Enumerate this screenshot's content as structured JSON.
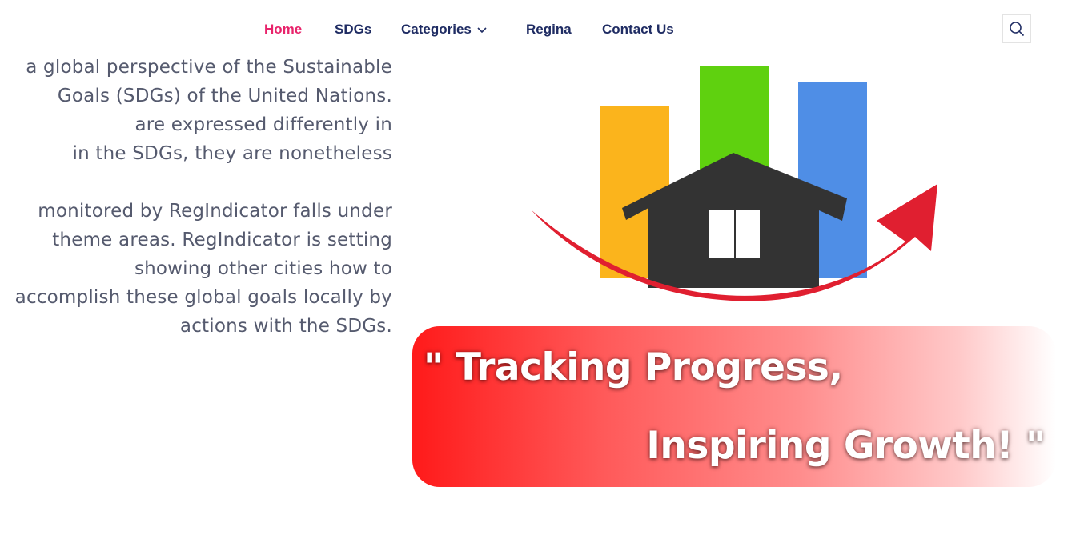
{
  "nav": {
    "items": [
      {
        "label": "Home",
        "active": true
      },
      {
        "label": "SDGs"
      },
      {
        "label": "Categories",
        "has_dropdown": true
      },
      {
        "label": "Regina"
      },
      {
        "label": "Contact Us"
      }
    ],
    "active_color": "#e8236b",
    "color": "#1f2c63",
    "search_icon": "search-icon"
  },
  "content": {
    "lines": [
      "a global perspective of the Sustainable",
      "Goals (SDGs) of the United Nations.",
      "are expressed differently in",
      "in the SDGs, they are nonetheless",
      "",
      "monitored by RegIndicator falls under",
      "theme areas. RegIndicator is setting",
      "showing other cities how to",
      "accomplish these global goals locally by",
      "actions with the SDGs."
    ]
  },
  "logo": {
    "bar_colors": [
      "#fbb41c",
      "#5fd10f",
      "#4f8ee6"
    ],
    "house_color": "#333333",
    "arrow_color": "#e01f30"
  },
  "banner": {
    "line1": "\" Tracking Progress,",
    "line2": "Inspiring Growth! \""
  }
}
